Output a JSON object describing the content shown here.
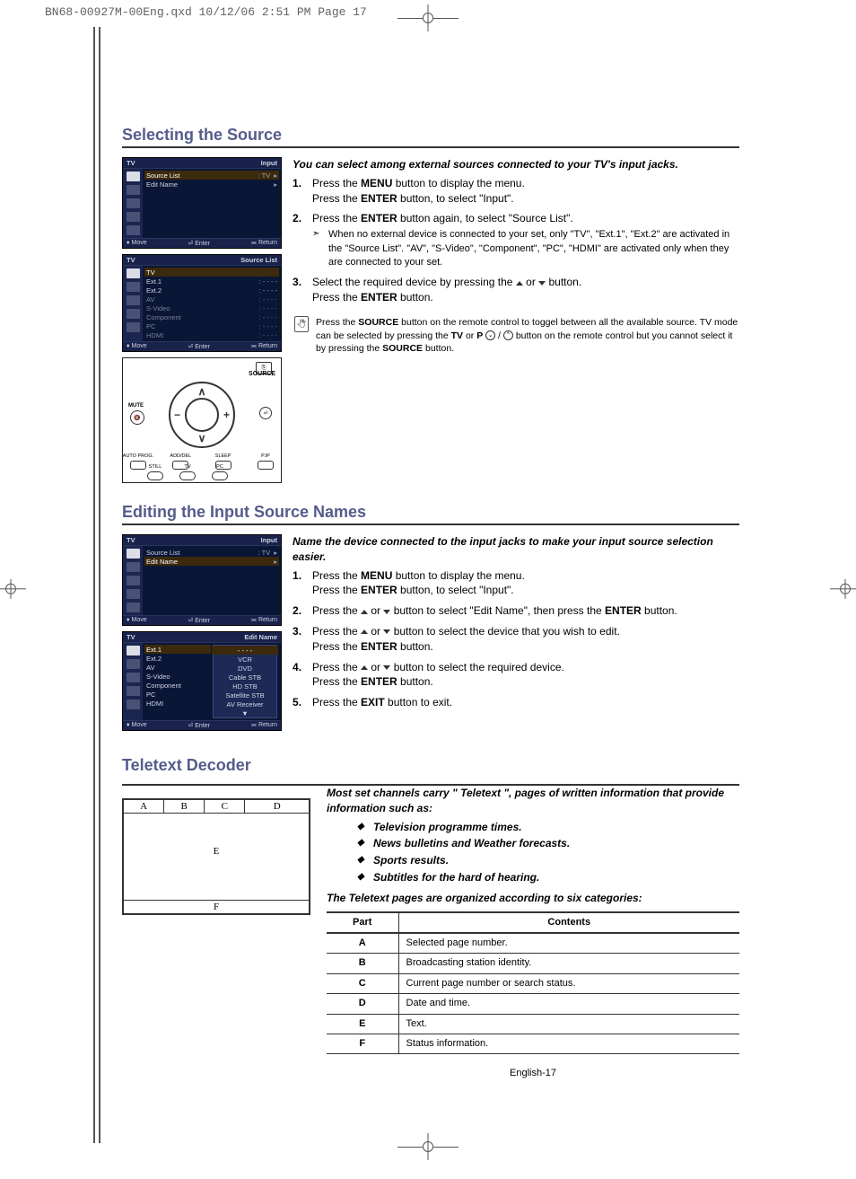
{
  "print_header": "BN68-00927M-00Eng.qxd  10/12/06 2:51 PM  Page 17",
  "section1": {
    "title": "Selecting the Source",
    "intro": "You can select among external sources connected to your TV's input jacks.",
    "steps": {
      "s1a": "Press the ",
      "s1b": "MENU",
      "s1c": " button to display the menu.",
      "s1d": "Press the ",
      "s1e": "ENTER",
      "s1f": " button, to select \"Input\".",
      "s2a": "Press the ",
      "s2b": "ENTER",
      "s2c": " button again, to select \"Source List\".",
      "s2note": "When no external device is connected to your set, only \"TV\", \"Ext.1\", \"Ext.2\" are activated in the \"Source List\". \"AV\", \"S-Video\", \"Component\", \"PC\", \"HDMI\" are activated only when they are connected to your set.",
      "s3a": "Select the required device by pressing the ",
      "s3b": " or ",
      "s3c": " button.",
      "s3d": "Press the ",
      "s3e": "ENTER",
      "s3f": " button."
    },
    "remote_note": {
      "a": "Press the ",
      "b": "SOURCE",
      "c": " button on the remote control to toggel between all the available source. TV mode can be selected by pressing the ",
      "d": "TV",
      "e": " or ",
      "f": "P",
      "g": " button on the remote control but you cannot select it by pressing the ",
      "h": "SOURCE",
      "i": " button."
    },
    "osd1": {
      "title_left": "TV",
      "title_right": "Input",
      "rows": [
        {
          "l": "Source List",
          "r": ": TV"
        },
        {
          "l": "Edit Name",
          "r": ""
        }
      ],
      "footer": [
        "♦ Move",
        "⏎ Enter",
        "⫘ Return"
      ]
    },
    "osd2": {
      "title_left": "TV",
      "title_right": "Source List",
      "rows": [
        {
          "l": "TV",
          "r": ""
        },
        {
          "l": "Ext.1",
          "r": ": - - - -"
        },
        {
          "l": "Ext.2",
          "r": ": - - - -"
        },
        {
          "l": "AV",
          "r": ": - - - -"
        },
        {
          "l": "S-Video",
          "r": ": - - - -"
        },
        {
          "l": "Component",
          "r": ": - - - -"
        },
        {
          "l": "PC",
          "r": ": - - - -"
        },
        {
          "l": "HDMI",
          "r": ": - - - -"
        }
      ],
      "footer": [
        "♦ Move",
        "⏎ Enter",
        "⫘ Return"
      ]
    },
    "remote_labels": {
      "source": "SOURCE",
      "mute": "MUTE",
      "btm": [
        "AUTO PROG.",
        "ADD/DEL",
        "SLEEP",
        "P.IP"
      ],
      "btm2": [
        "STILL",
        "TV",
        "PC"
      ]
    }
  },
  "section2": {
    "title": "Editing the Input Source Names",
    "intro": "Name the device connected to the input jacks to make your input source selection easier.",
    "steps": {
      "s1a": "Press the ",
      "s1b": "MENU",
      "s1c": " button to display the menu.",
      "s1d": "Press the ",
      "s1e": "ENTER",
      "s1f": " button, to select \"Input\".",
      "s2a": "Press the ",
      "s2b": " or ",
      "s2c": " button to select \"Edit Name\", then press the ",
      "s2d": "ENTER",
      "s2e": " button.",
      "s3a": "Press the ",
      "s3b": " or ",
      "s3c": " button to select the device that you wish to edit.",
      "s3d": "Press the ",
      "s3e": "ENTER",
      "s3f": " button.",
      "s4a": "Press the ",
      "s4b": " or ",
      "s4c": " button to select the required device.",
      "s4d": "Press the ",
      "s4e": "ENTER",
      "s4f": " button.",
      "s5a": "Press the ",
      "s5b": "EXIT",
      "s5c": " button to exit."
    },
    "osd1": {
      "title_left": "TV",
      "title_right": "Input",
      "rows": [
        {
          "l": "Source List",
          "r": ": TV"
        },
        {
          "l": "Edit Name",
          "r": ""
        }
      ],
      "footer": [
        "♦ Move",
        "⏎ Enter",
        "⫘ Return"
      ]
    },
    "osd2": {
      "title_left": "TV",
      "title_right": "Edit Name",
      "left_rows": [
        "Ext.1",
        "Ext.2",
        "AV",
        "S-Video",
        "Component",
        "PC",
        "HDMI"
      ],
      "right_rows": [
        "- - - -",
        "VCR",
        "DVD",
        "Cable STB",
        "HD STB",
        "Satellite STB",
        "AV Receiver",
        "▼"
      ],
      "footer": [
        "♦ Move",
        "⏎ Enter",
        "⫘ Return"
      ]
    }
  },
  "section3": {
    "title": "Teletext Decoder",
    "intro": "Most set channels carry \" Teletext \", pages of written information that provide information such as:",
    "bullets": [
      "Television programme times.",
      "News bulletins and Weather forecasts.",
      "Sports results.",
      "Subtitles for the hard of hearing."
    ],
    "org_line": "The Teletext pages are organized according to six categories:",
    "diagram": {
      "A": "A",
      "B": "B",
      "C": "C",
      "D": "D",
      "E": "E",
      "F": "F"
    },
    "table": {
      "header": [
        "Part",
        "Contents"
      ],
      "rows": [
        [
          "A",
          "Selected page number."
        ],
        [
          "B",
          "Broadcasting station identity."
        ],
        [
          "C",
          "Current page number or search status."
        ],
        [
          "D",
          "Date and time."
        ],
        [
          "E",
          "Text."
        ],
        [
          "F",
          "Status information."
        ]
      ]
    }
  },
  "page_no": "English-17"
}
